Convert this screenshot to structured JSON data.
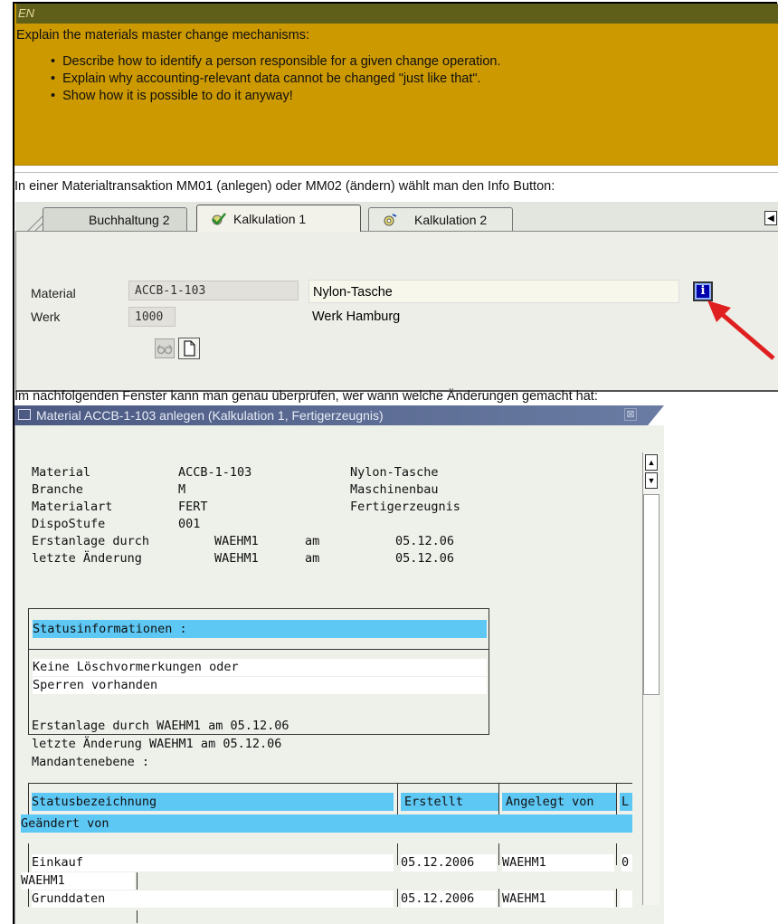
{
  "header": {
    "lang": "EN",
    "intro": "Explain the materials master change mechanisms:",
    "bullets": [
      "Describe how to identify a person responsible for a given change operation.",
      "Explain why accounting-relevant data cannot be changed \"just like that\".",
      "Show how it is possible to do it anyway!"
    ]
  },
  "captions": {
    "first": "In einer Materialtransaktion MM01 (anlegen) oder MM02 (ändern) wählt man den Info Button:",
    "second": "Im nachfolgenden Fenster kann man genau überprüfen, wer wann welche Änderungen gemacht hat:"
  },
  "tabs": [
    "Buchhaltung 2",
    "Kalkulation 1",
    "Kalkulation 2"
  ],
  "form": {
    "material_label": "Material",
    "material_value": "ACCB-1-103",
    "material_desc": "Nylon-Tasche",
    "werk_label": "Werk",
    "werk_value": "1000",
    "werk_desc": "Werk Hamburg"
  },
  "dialog": {
    "title": "Material ACCB-1-103 anlegen (Kalkulation 1, Fertigerzeugnis)",
    "lines": [
      [
        "Material",
        "ACCB-1-103",
        "Nylon-Tasche"
      ],
      [
        "Branche",
        "M",
        "Maschinenbau"
      ],
      [
        "Materialart",
        "FERT",
        "Fertigerzeugnis"
      ],
      [
        "DispoStufe",
        "001",
        ""
      ]
    ],
    "erstanlage": [
      "Erstanlage durch",
      "WAEHM1",
      "am",
      "05.12.06"
    ],
    "letzte": [
      "letzte Änderung",
      "WAEHM1",
      "am",
      "05.12.06"
    ],
    "status_title": "Statusinformationen :",
    "status_lines": [
      "Keine Löschvormerkungen oder",
      "Sperren vorhanden"
    ],
    "summary": [
      "Erstanlage durch WAEHM1 am 05.12.06",
      "letzte Änderung WAEHM1 am 05.12.06",
      "Mandantenebene :"
    ],
    "table_headers": [
      "Statusbezeichnung",
      "Erstellt",
      "Angelegt von",
      "L"
    ],
    "table_header_wrap": "Geändert von",
    "rows": [
      {
        "name": "Einkauf",
        "date": "05.12.2006",
        "by": "WAEHM1",
        "extra": "0",
        "wrap": "WAEHM1"
      },
      {
        "name": "Grunddaten",
        "date": "05.12.2006",
        "by": "WAEHM1",
        "extra": "",
        "wrap": ""
      }
    ]
  },
  "colors": {
    "header_bg": "#cc9900",
    "lang_bar": "#5f5f1a",
    "highlight": "#5ec8f5",
    "title_bar": "#4c5a83",
    "arrow": "#e02020"
  }
}
